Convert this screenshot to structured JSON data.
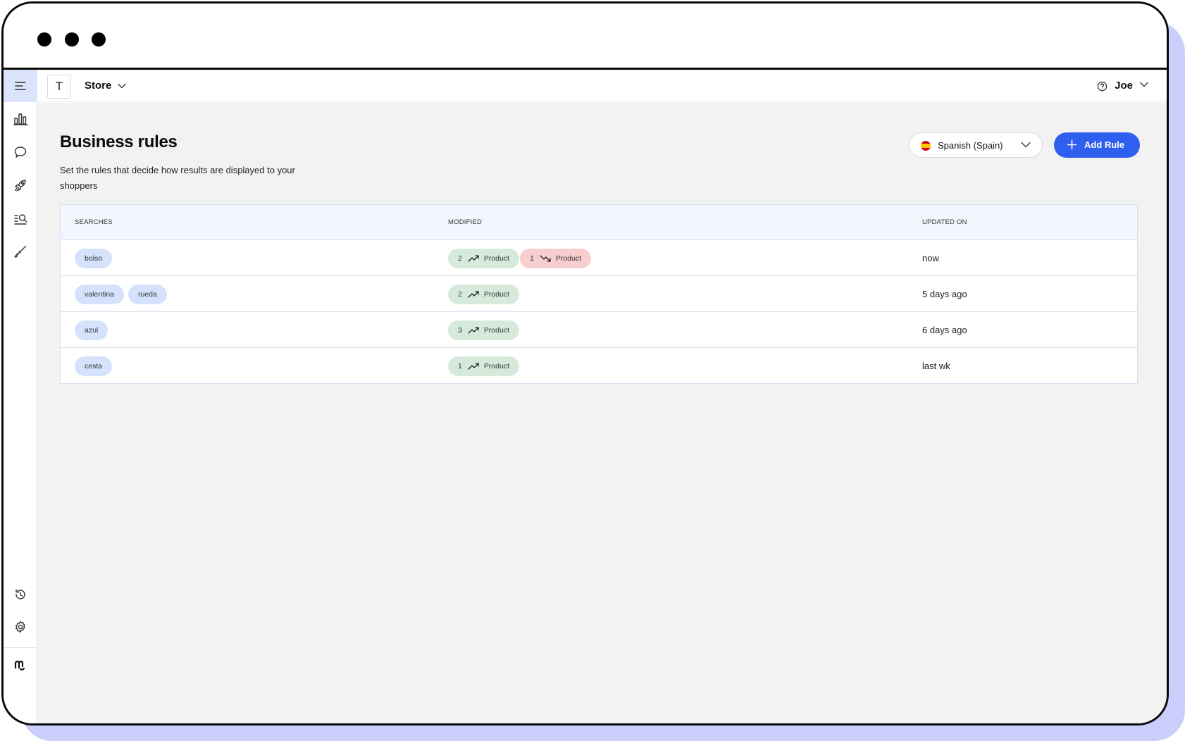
{
  "window": {
    "controls": [
      "close-dot",
      "minimize-dot",
      "maximize-dot"
    ]
  },
  "sidebar": {
    "items": [
      {
        "name": "menu",
        "icon": "menu-icon"
      },
      {
        "name": "analytics",
        "icon": "bar-chart-icon"
      },
      {
        "name": "messages",
        "icon": "chat-bubble-icon"
      },
      {
        "name": "launch",
        "icon": "rocket-icon"
      },
      {
        "name": "search-list",
        "icon": "list-search-icon"
      },
      {
        "name": "design",
        "icon": "brush-icon"
      },
      {
        "name": "history",
        "icon": "history-icon"
      },
      {
        "name": "settings",
        "icon": "gear-icon"
      },
      {
        "name": "brand",
        "icon": "logo-icon"
      }
    ]
  },
  "topbar": {
    "store_initial": "T",
    "store_name": "Store",
    "user_name": "Joe"
  },
  "page": {
    "title": "Business rules",
    "subtitle": "Set the rules that decide how results are displayed to your shoppers"
  },
  "language": {
    "selected": "Spanish (Spain)"
  },
  "actions": {
    "add_rule": "Add Rule"
  },
  "table": {
    "headers": {
      "searches": "SEARCHES",
      "modified": "MODIFIED",
      "updated": "UPDATED ON"
    },
    "rows": [
      {
        "searches": [
          "bolso"
        ],
        "modified": [
          {
            "count": "2",
            "trend": "up",
            "label": "Product"
          },
          {
            "count": "1",
            "trend": "down",
            "label": "Product"
          }
        ],
        "updated": "now"
      },
      {
        "searches": [
          "valentina",
          "rueda"
        ],
        "modified": [
          {
            "count": "2",
            "trend": "up",
            "label": "Product"
          }
        ],
        "updated": "5 days ago"
      },
      {
        "searches": [
          "azul"
        ],
        "modified": [
          {
            "count": "3",
            "trend": "up",
            "label": "Product"
          }
        ],
        "updated": "6 days ago"
      },
      {
        "searches": [
          "cesta"
        ],
        "modified": [
          {
            "count": "1",
            "trend": "up",
            "label": "Product"
          }
        ],
        "updated": "last wk"
      }
    ]
  },
  "colors": {
    "primary": "#2f5fef",
    "search_chip": "#d6e2fb",
    "boost_chip": "#d6eadc",
    "bury_chip": "#f8cdcd",
    "backdrop": "#c9cefa"
  }
}
